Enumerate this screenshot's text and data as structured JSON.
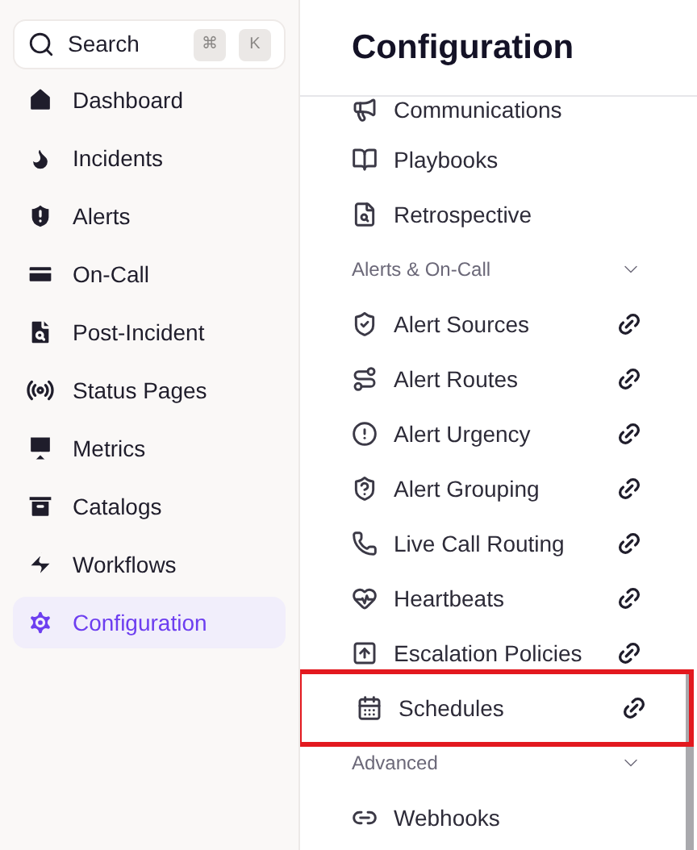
{
  "sidebar": {
    "search": {
      "placeholder": "Search",
      "keys": [
        "⌘",
        "K"
      ]
    },
    "items": [
      {
        "label": "Dashboard",
        "selected": false
      },
      {
        "label": "Incidents",
        "selected": false
      },
      {
        "label": "Alerts",
        "selected": false
      },
      {
        "label": "On-Call",
        "selected": false
      },
      {
        "label": "Post-Incident",
        "selected": false
      },
      {
        "label": "Status Pages",
        "selected": false
      },
      {
        "label": "Metrics",
        "selected": false
      },
      {
        "label": "Catalogs",
        "selected": false
      },
      {
        "label": "Workflows",
        "selected": false
      },
      {
        "label": "Configuration",
        "selected": true
      }
    ]
  },
  "panel": {
    "title": "Configuration",
    "entries": [
      {
        "kind": "item",
        "label": "Communications",
        "linked": false,
        "highlighted": false
      },
      {
        "kind": "item",
        "label": "Playbooks",
        "linked": false,
        "highlighted": false
      },
      {
        "kind": "item",
        "label": "Retrospective",
        "linked": false,
        "highlighted": false
      },
      {
        "kind": "section",
        "label": "Alerts & On-Call",
        "expanded": true
      },
      {
        "kind": "item",
        "label": "Alert Sources",
        "linked": true,
        "highlighted": false
      },
      {
        "kind": "item",
        "label": "Alert Routes",
        "linked": true,
        "highlighted": false
      },
      {
        "kind": "item",
        "label": "Alert Urgency",
        "linked": true,
        "highlighted": false
      },
      {
        "kind": "item",
        "label": "Alert Grouping",
        "linked": true,
        "highlighted": false
      },
      {
        "kind": "item",
        "label": "Live Call Routing",
        "linked": true,
        "highlighted": false
      },
      {
        "kind": "item",
        "label": "Heartbeats",
        "linked": true,
        "highlighted": false
      },
      {
        "kind": "item",
        "label": "Escalation Policies",
        "linked": true,
        "highlighted": false
      },
      {
        "kind": "item",
        "label": "Schedules",
        "linked": true,
        "highlighted": true
      },
      {
        "kind": "section",
        "label": "Advanced",
        "expanded": true
      },
      {
        "kind": "item",
        "label": "Webhooks",
        "linked": false,
        "highlighted": false
      }
    ]
  }
}
